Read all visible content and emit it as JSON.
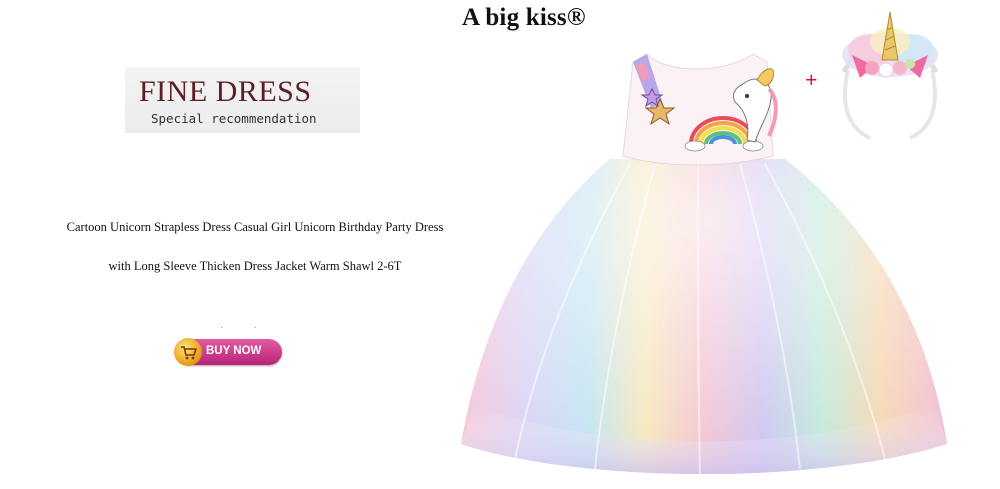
{
  "brand": {
    "title": "A big kiss®"
  },
  "logo": {
    "title": "FINE DRESS",
    "subtitle": "Special recommendation"
  },
  "product": {
    "line1": "Cartoon Unicorn Strapless Dress Casual Girl Unicorn Birthday Party Dress",
    "line2": "with Long Sleeve Thicken Dress Jacket Warm Shawl 2-6T"
  },
  "cta": {
    "label": "BUY NOW"
  },
  "plus": "+",
  "colors": {
    "button": "#c32f86",
    "logo_text": "#5a1f24",
    "plus": "#d2192a"
  }
}
